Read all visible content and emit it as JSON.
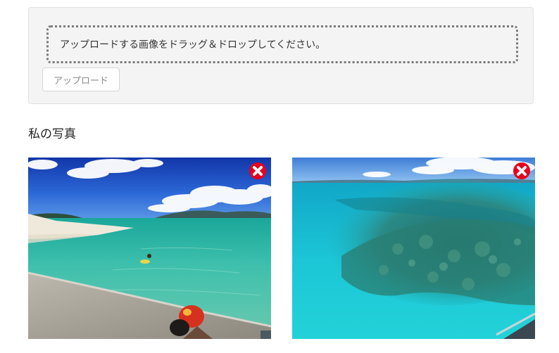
{
  "upload": {
    "drop_text": "アップロードする画像をドラッグ＆ドロップしてください。",
    "button_label": "アップロード"
  },
  "gallery": {
    "title": "私の写真",
    "photos": [
      {
        "icon": "delete-icon"
      },
      {
        "icon": "delete-icon"
      }
    ]
  },
  "colors": {
    "panel_bg": "#f4f4f4",
    "delete_red": "#e8001c"
  }
}
